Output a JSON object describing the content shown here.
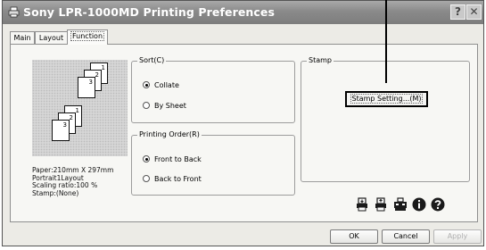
{
  "window": {
    "title": "Sony LPR-1000MD Printing Preferences",
    "help_glyph": "?",
    "close_glyph": "✕"
  },
  "tabs": [
    {
      "label": "Main",
      "active": false
    },
    {
      "label": "Layout",
      "active": false
    },
    {
      "label": "Function",
      "active": true
    }
  ],
  "preview": {
    "set1_pages": [
      "1",
      "2",
      "3"
    ],
    "set2_pages": [
      "1",
      "2",
      "3"
    ],
    "info_lines": [
      "Paper:210mm X 297mm",
      "Portrait1Layout",
      "Scaling ratio:100 %",
      "Stamp:(None)"
    ]
  },
  "sort": {
    "legend": "Sort(C)",
    "options": [
      {
        "label": "Collate",
        "selected": true
      },
      {
        "label": "By Sheet",
        "selected": false
      }
    ]
  },
  "printing_order": {
    "legend": "Printing Order(R)",
    "options": [
      {
        "label": "Front to Back",
        "selected": true
      },
      {
        "label": "Back to Front",
        "selected": false
      }
    ]
  },
  "stamp": {
    "legend": "Stamp",
    "button_label": "Stamp Setting...(M)"
  },
  "toolbar_icons": [
    "printer-down-icon",
    "printer-up-icon",
    "printer-network-icon",
    "info-icon",
    "help-icon"
  ],
  "buttons": {
    "ok": "OK",
    "cancel": "Cancel",
    "apply": "Apply"
  },
  "colors": {
    "titlebar": "#8c8c8c",
    "dialog_bg": "#ecebe6",
    "panel_bg": "#f7f7f4",
    "icon_fill": "#1a1a1a"
  }
}
